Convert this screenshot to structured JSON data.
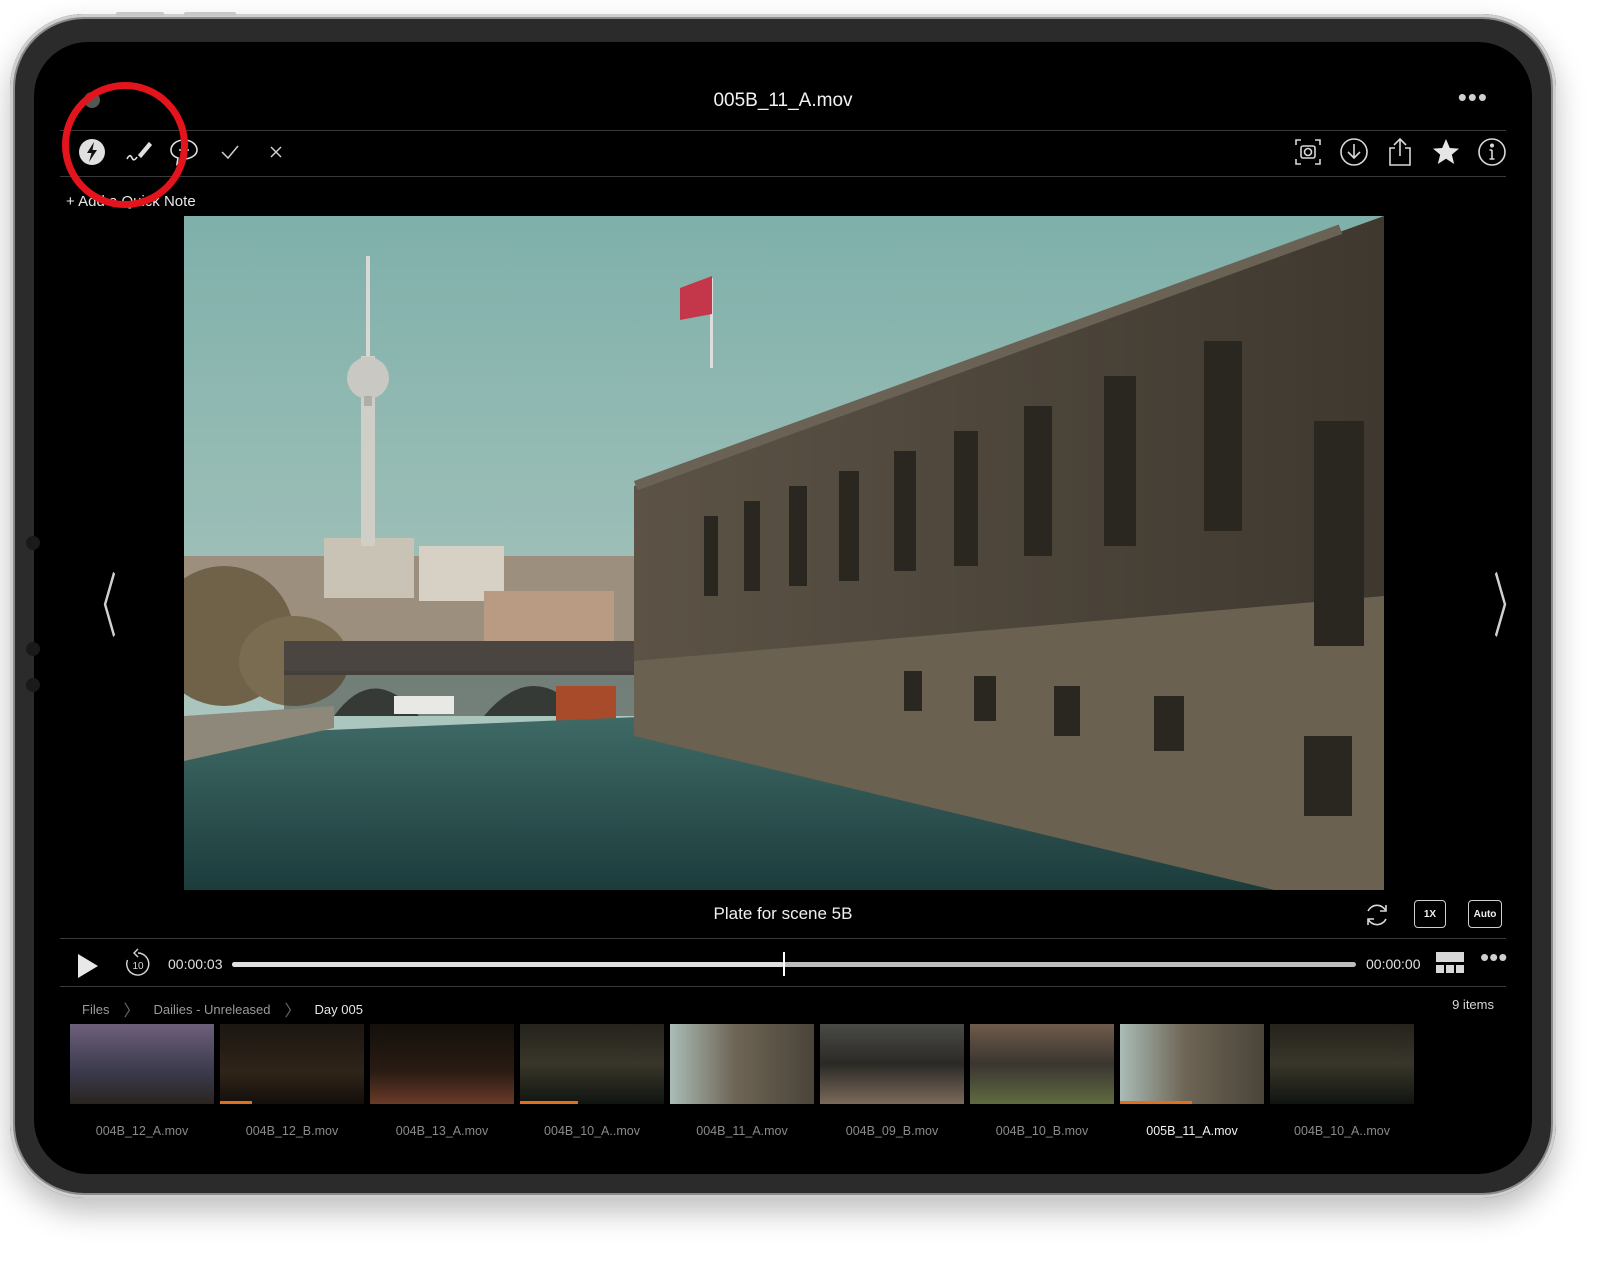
{
  "title": "005B_11_A.mov",
  "toolbar_left": [
    "lightning-icon",
    "pen-icon",
    "comment-add-icon",
    "checkmark-icon",
    "close-icon"
  ],
  "toolbar_right": [
    "snapshot-icon",
    "download-icon",
    "share-icon",
    "star-icon",
    "info-icon"
  ],
  "quick_note": "+ Add a Quick Note",
  "caption": "Plate for scene 5B",
  "speed_label": "1X",
  "quality_label": "Auto",
  "player": {
    "time_current": "00:00:03",
    "time_remaining": "00:00:00",
    "progress": 0.49,
    "skip_label": "10"
  },
  "breadcrumb": [
    "Files",
    "Dailies - Unreleased",
    "Day 005"
  ],
  "items_count": "9 items",
  "thumbnails": [
    {
      "label": "004B_12_A.mov",
      "progress": 0,
      "selected": false
    },
    {
      "label": "004B_12_B.mov",
      "progress": 0.22,
      "selected": false
    },
    {
      "label": "004B_13_A.mov",
      "progress": 0,
      "selected": false
    },
    {
      "label": "004B_10_A..mov",
      "progress": 0.4,
      "selected": false
    },
    {
      "label": "004B_11_A.mov",
      "progress": 0,
      "selected": false
    },
    {
      "label": "004B_09_B.mov",
      "progress": 0,
      "selected": false
    },
    {
      "label": "004B_10_B.mov",
      "progress": 0,
      "selected": false
    },
    {
      "label": "005B_11_A.mov",
      "progress": 0.5,
      "selected": true
    },
    {
      "label": "004B_10_A..mov",
      "progress": 0,
      "selected": false
    }
  ],
  "colors": {
    "highlight_circle": "#e3141b",
    "progress_accent": "#e0701e"
  }
}
